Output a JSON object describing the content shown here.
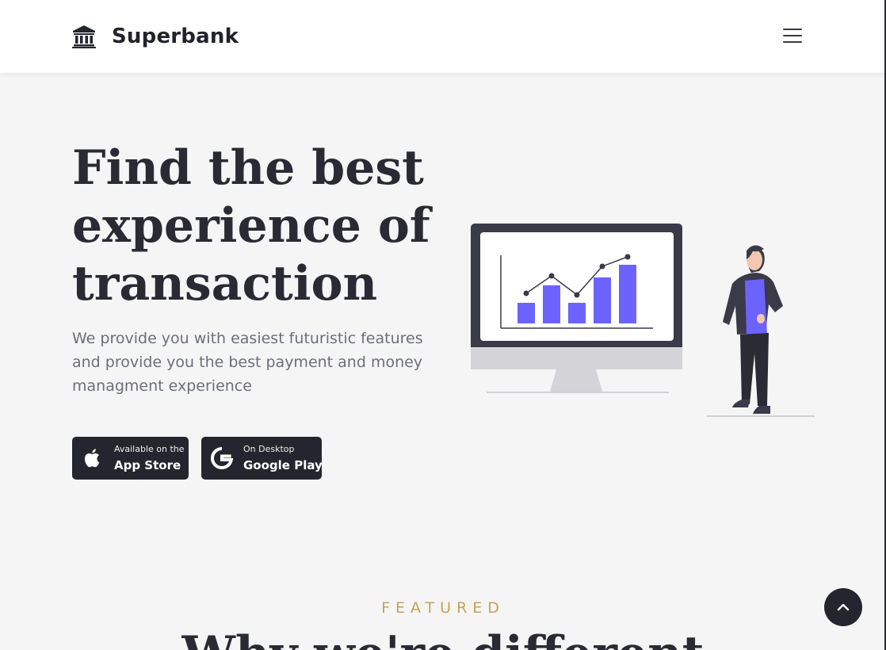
{
  "navbar": {
    "brand_name": "Superbank",
    "brand_icon": "bank-icon",
    "menu_icon": "hamburger-menu-icon"
  },
  "hero": {
    "title_lines": [
      "Find the best",
      "experience of",
      "transaction"
    ],
    "subtitle": "We provide you with easiest futuristic features and provide you the best payment and money managment experience"
  },
  "store_buttons": {
    "apple": {
      "small": "Available on the",
      "big": "App Store",
      "icon": "apple-icon"
    },
    "google": {
      "small": "On Desktop",
      "big": "Google Play",
      "icon": "google-icon"
    }
  },
  "featured": {
    "label": "FEATURED",
    "title": "Why we're different"
  },
  "back_to_top_icon": "chevron-up-icon",
  "colors": {
    "accent_bar": "#6c63ff",
    "dark": "#25252f",
    "gold": "#c9a154",
    "background": "#f5f5f6"
  }
}
